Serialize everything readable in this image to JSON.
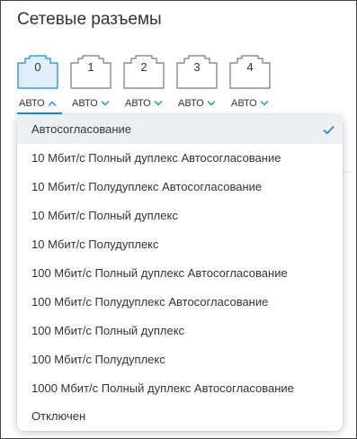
{
  "title": "Сетевые разъемы",
  "accent_color": "#1f8bd6",
  "ports": [
    {
      "label": "0",
      "mode": "АВТО",
      "selected": true,
      "chevron": "chevron-up-icon"
    },
    {
      "label": "1",
      "mode": "АВТО",
      "selected": false,
      "chevron": "chevron-down-icon"
    },
    {
      "label": "2",
      "mode": "АВТО",
      "selected": false,
      "chevron": "chevron-down-icon"
    },
    {
      "label": "3",
      "mode": "АВТО",
      "selected": false,
      "chevron": "chevron-down-icon"
    },
    {
      "label": "4",
      "mode": "АВТО",
      "selected": false,
      "chevron": "chevron-down-icon"
    }
  ],
  "dropdown": {
    "selected_index": 0,
    "options": [
      "Автосогласование",
      "10 Мбит/с Полный дуплекс Автосогласование",
      "10 Мбит/с Полудуплекс Автосогласование",
      "10 Мбит/с Полный дуплекс",
      "10 Мбит/с Полудуплекс",
      "100 Мбит/с Полный дуплекс Автосогласование",
      "100 Мбит/с Полудуплекс Автосогласование",
      "100 Мбит/с Полный дуплекс",
      "100 Мбит/с Полудуплекс",
      "1000 Мбит/с Полный дуплекс Автосогласование",
      "Отключен"
    ]
  }
}
